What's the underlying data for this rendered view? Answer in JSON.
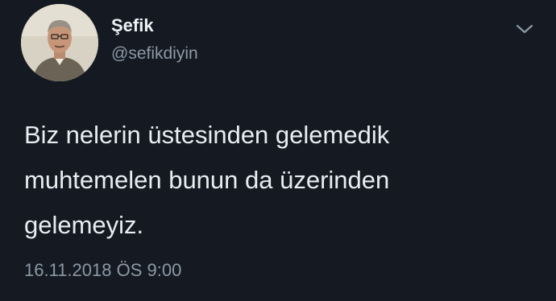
{
  "author": {
    "name": "Şefik",
    "handle": "@sefikdiyin",
    "avatar_icon": "profile-photo"
  },
  "menu_icon": "chevron-down-icon",
  "tweet": {
    "lines": [
      "Biz nelerin üstesinden gelemedik",
      "muhtemelen bunun da üzerinden",
      "gelemeyiz."
    ],
    "timestamp": "16.11.2018 ÖS 9:00"
  },
  "colors": {
    "background": "#151a22",
    "text_primary": "#e8edf1",
    "text_secondary": "#8b98a5"
  }
}
